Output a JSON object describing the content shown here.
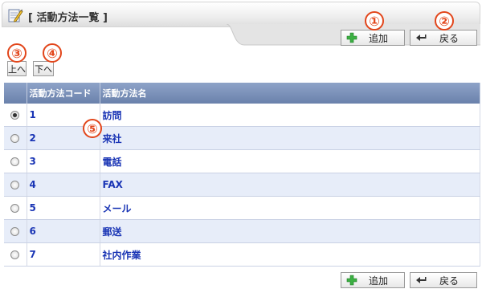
{
  "header": {
    "title": "[ 活動方法一覧 ]",
    "add_label": "追加",
    "back_label": "戻る"
  },
  "nav": {
    "up_label": "上へ",
    "down_label": "下へ"
  },
  "annotations": [
    "①",
    "②",
    "③",
    "④",
    "⑤"
  ],
  "table": {
    "columns": [
      "",
      "活動方法コード",
      "活動方法名"
    ],
    "rows": [
      {
        "code": "1",
        "name": "訪問",
        "selected": true
      },
      {
        "code": "2",
        "name": "来社",
        "selected": false
      },
      {
        "code": "3",
        "name": "電話",
        "selected": false
      },
      {
        "code": "4",
        "name": "FAX",
        "selected": false
      },
      {
        "code": "5",
        "name": "メール",
        "selected": false
      },
      {
        "code": "6",
        "name": "郵送",
        "selected": false
      },
      {
        "code": "7",
        "name": "社内作業",
        "selected": false
      }
    ]
  },
  "footer": {
    "add_label": "追加",
    "back_label": "戻る"
  },
  "colors": {
    "header_row": "#7b90b8",
    "row_alt": "#e7edf9",
    "link_text": "#1a35b5",
    "badge": "#e2451a"
  }
}
